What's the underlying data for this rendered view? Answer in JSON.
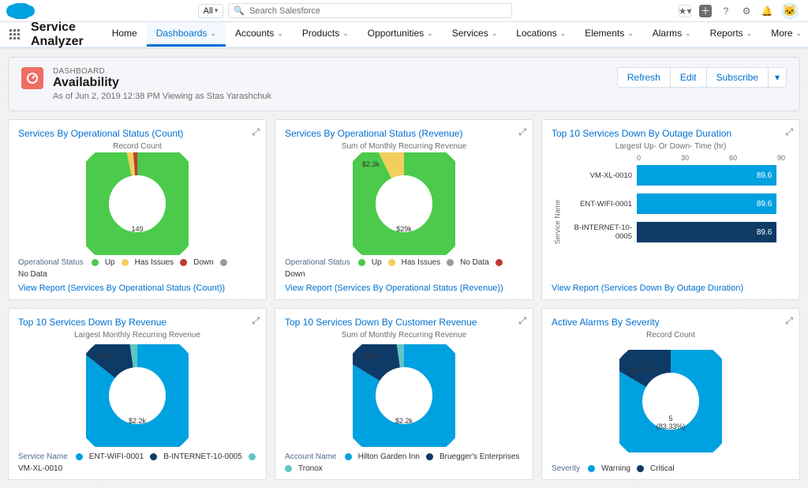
{
  "header": {
    "search_scope": "All",
    "search_placeholder": "Search Salesforce"
  },
  "nav": {
    "app_name": "Service Analyzer",
    "items": [
      "Home",
      "Dashboards",
      "Accounts",
      "Products",
      "Opportunities",
      "Services",
      "Locations",
      "Elements",
      "Alarms",
      "Reports",
      "More"
    ],
    "active_index": 1
  },
  "page": {
    "eyebrow": "DASHBOARD",
    "title": "Availability",
    "subtitle": "As of Jun 2, 2019 12:38 PM Viewing as Stas Yarashchuk",
    "actions": {
      "refresh": "Refresh",
      "edit": "Edit",
      "subscribe": "Subscribe"
    }
  },
  "colors": {
    "up": "#4bca4b",
    "has_issues": "#f2cf5b",
    "down": "#c23934",
    "no_data": "#9b9b9b",
    "blue": "#00a1e0",
    "darkblue": "#0d3a66",
    "teal": "#5ec6c6"
  },
  "chart_data": [
    {
      "id": "svc_status_count",
      "type": "donut",
      "title": "Services By Operational Status (Count)",
      "subtitle": "Record Count",
      "legend_label": "Operational Status",
      "series": [
        {
          "name": "Up",
          "value": 149,
          "color": "#4bca4b"
        },
        {
          "name": "Has Issues",
          "value": 3,
          "color": "#f2cf5b"
        },
        {
          "name": "Down",
          "value": 2,
          "color": "#c23934"
        },
        {
          "name": "No Data",
          "value": 0,
          "color": "#9b9b9b"
        }
      ],
      "center_label": "149",
      "view_report": "View Report (Services By Operational Status (Count))"
    },
    {
      "id": "svc_status_revenue",
      "type": "donut",
      "title": "Services By Operational Status (Revenue)",
      "subtitle": "Sum of Monthly Recurring Revenue",
      "legend_label": "Operational Status",
      "series": [
        {
          "name": "Up",
          "value": 29000,
          "label": "$29k",
          "color": "#4bca4b"
        },
        {
          "name": "Has Issues",
          "value": 2300,
          "label": "$2.3k",
          "color": "#f2cf5b"
        },
        {
          "name": "No Data",
          "value": 0,
          "color": "#9b9b9b"
        },
        {
          "name": "Down",
          "value": 0,
          "color": "#c23934"
        }
      ],
      "center_label": "$29k",
      "callout": "$2.3k",
      "view_report": "View Report (Services By Operational Status (Revenue))"
    },
    {
      "id": "top10_outage",
      "type": "bar",
      "title": "Top 10 Services Down By Outage Duration",
      "axis_title": "Largest Up- Or Down- Time (hr)",
      "xticks": [
        "0",
        "30",
        "60",
        "90"
      ],
      "xlim": [
        0,
        95
      ],
      "y_axis_label": "Service Name",
      "categories": [
        "VM-XL-0010",
        "ENT-WIFI-0001",
        "B-INTERNET-10-0005"
      ],
      "values": [
        89.6,
        89.6,
        89.6
      ],
      "colors": [
        "#00a1e0",
        "#00a1e0",
        "#0d3a66"
      ],
      "view_report": "View Report (Services Down By Outage Duration)"
    },
    {
      "id": "top10_down_revenue",
      "type": "donut",
      "title": "Top 10 Services Down By Revenue",
      "subtitle": "Largest Monthly Recurring Revenue",
      "legend_label": "Service Name",
      "series": [
        {
          "name": "ENT-WIFI-0001",
          "value": 2200,
          "label": "$2.2k",
          "color": "#00a1e0"
        },
        {
          "name": "B-INTERNET-10-0005",
          "value": 309,
          "label": "$309",
          "color": "#0d3a66"
        },
        {
          "name": "VM-XL-0010",
          "value": 60,
          "color": "#5ec6c6"
        }
      ],
      "center_label": "$2.2k",
      "callout": "$309"
    },
    {
      "id": "top10_down_customer",
      "type": "donut",
      "title": "Top 10 Services Down By Customer Revenue",
      "subtitle": "Sum of Monthly Recurring Revenue",
      "legend_label": "Account Name",
      "series": [
        {
          "name": "Hilton Garden Inn",
          "value": 2200,
          "label": "$2.2k",
          "color": "#00a1e0"
        },
        {
          "name": "Bruegger's Enterprises",
          "value": 369,
          "label": "$369",
          "color": "#0d3a66"
        },
        {
          "name": "Tronox",
          "value": 60,
          "color": "#5ec6c6"
        }
      ],
      "center_label": "$2.2k",
      "callout": "$369"
    },
    {
      "id": "alarms_severity",
      "type": "donut",
      "title": "Active Alarms By Severity",
      "subtitle": "Record Count",
      "legend_label": "Severity",
      "series": [
        {
          "name": "Warning",
          "value": 5,
          "label": "5 (83.33%)",
          "color": "#00a1e0"
        },
        {
          "name": "Critical",
          "value": 1,
          "label": "1 (16.67%)",
          "color": "#0d3a66"
        }
      ],
      "center_label": "5\n(83.33%)",
      "callout": "1\n(16.67%)"
    }
  ]
}
